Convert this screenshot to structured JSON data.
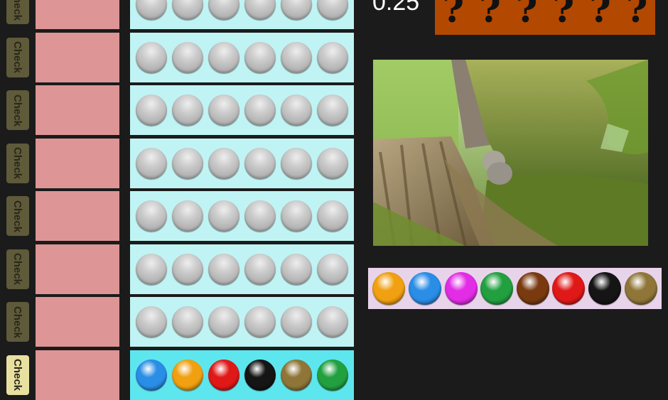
{
  "timer": "0:25",
  "check_label": "Check",
  "secret_code": [
    "?",
    "?",
    "?",
    "?",
    "?",
    "?"
  ],
  "peg_colors": {
    "empty": "#c8c8c8",
    "orange": "#f0a010",
    "blue": "#2a8de6",
    "magenta": "#e22ce6",
    "green": "#22a040",
    "brown": "#7a3a10",
    "red": "#e01818",
    "black": "#151515",
    "olive": "#8f7638"
  },
  "board": {
    "guess_rows": [
      {
        "pegs": [
          "empty",
          "empty",
          "empty",
          "empty",
          "empty",
          "empty"
        ]
      },
      {
        "pegs": [
          "empty",
          "empty",
          "empty",
          "empty",
          "empty",
          "empty"
        ]
      },
      {
        "pegs": [
          "empty",
          "empty",
          "empty",
          "empty",
          "empty",
          "empty"
        ]
      },
      {
        "pegs": [
          "empty",
          "empty",
          "empty",
          "empty",
          "empty",
          "empty"
        ]
      },
      {
        "pegs": [
          "empty",
          "empty",
          "empty",
          "empty",
          "empty",
          "empty"
        ]
      },
      {
        "pegs": [
          "empty",
          "empty",
          "empty",
          "empty",
          "empty",
          "empty"
        ]
      },
      {
        "pegs": [
          "empty",
          "empty",
          "empty",
          "empty",
          "empty",
          "empty"
        ]
      },
      {
        "pegs": [
          "blue",
          "orange",
          "red",
          "black",
          "olive",
          "green"
        ]
      }
    ]
  },
  "palette": [
    "orange",
    "blue",
    "magenta",
    "green",
    "brown",
    "red",
    "black",
    "olive"
  ]
}
